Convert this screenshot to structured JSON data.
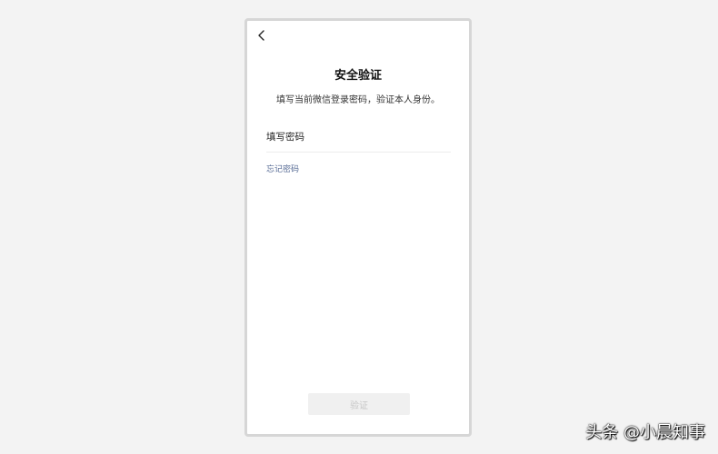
{
  "header": {
    "back_icon": "chevron-left-icon",
    "title": "安全验证",
    "subtitle": "填写当前微信登录密码，验证本人身份。"
  },
  "form": {
    "password_placeholder": "填写密码",
    "password_value": "",
    "forgot_label": "忘记密码",
    "verify_label": "验证"
  },
  "watermark": {
    "text": "头条 @小晨知事"
  },
  "colors": {
    "background": "#f3f3f3",
    "link": "#576b95",
    "button_disabled_bg": "#f0f0f0",
    "button_disabled_text": "#c6c6c6"
  }
}
